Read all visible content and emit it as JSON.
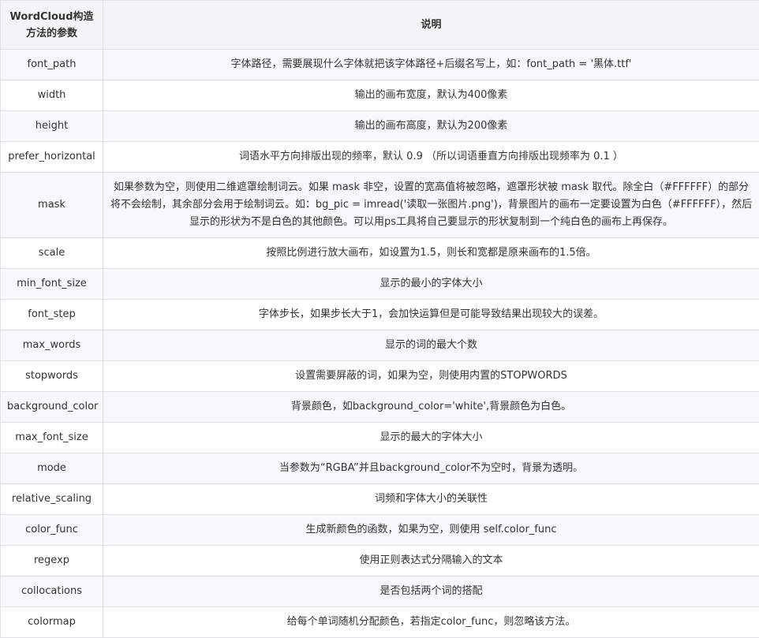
{
  "table": {
    "headers": [
      "WordCloud构造方法的参数",
      "说明"
    ],
    "rows": [
      {
        "param": "font_path",
        "desc": "字体路径，需要展现什么字体就把该字体路径+后缀名写上，如：font_path = '黑体.ttf'"
      },
      {
        "param": "width",
        "desc": "输出的画布宽度，默认为400像素"
      },
      {
        "param": "height",
        "desc": "输出的画布高度，默认为200像素"
      },
      {
        "param": "prefer_horizontal",
        "desc": "词语水平方向排版出现的频率，默认 0.9 （所以词语垂直方向排版出现频率为 0.1 ）"
      },
      {
        "param": "mask",
        "desc": "如果参数为空，则使用二维遮罩绘制词云。如果 mask 非空，设置的宽高值将被忽略，遮罩形状被 mask 取代。除全白（#FFFFFF）的部分将不会绘制，其余部分会用于绘制词云。如：bg_pic = imread('读取一张图片.png')，背景图片的画布一定要设置为白色（#FFFFFF），然后显示的形状为不是白色的其他颜色。可以用ps工具将自己要显示的形状复制到一个纯白色的画布上再保存。"
      },
      {
        "param": "scale",
        "desc": "按照比例进行放大画布，如设置为1.5，则长和宽都是原来画布的1.5倍。"
      },
      {
        "param": "min_font_size",
        "desc": "显示的最小的字体大小"
      },
      {
        "param": "font_step",
        "desc": "字体步长，如果步长大于1，会加快运算但是可能导致结果出现较大的误差。"
      },
      {
        "param": "max_words",
        "desc": "显示的词的最大个数"
      },
      {
        "param": "stopwords",
        "desc": "设置需要屏蔽的词，如果为空，则使用内置的STOPWORDS"
      },
      {
        "param": "background_color",
        "desc": "背景颜色，如background_color='white',背景颜色为白色。"
      },
      {
        "param": "max_font_size",
        "desc": "显示的最大的字体大小"
      },
      {
        "param": "mode",
        "desc": "当参数为“RGBA”并且background_color不为空时，背景为透明。"
      },
      {
        "param": "relative_scaling",
        "desc": "词频和字体大小的关联性"
      },
      {
        "param": "color_func",
        "desc": "生成新颜色的函数，如果为空，则使用 self.color_func"
      },
      {
        "param": "regexp",
        "desc": "使用正则表达式分隔输入的文本"
      },
      {
        "param": "collocations",
        "desc": "是否包括两个词的搭配"
      },
      {
        "param": "colormap",
        "desc": "给每个单词随机分配颜色，若指定color_func，则忽略该方法。"
      }
    ]
  },
  "colors": {
    "header_bg": "#f2f4f5",
    "stripe_bg": "#f6f8fa",
    "border": "#dfe2e5",
    "text": "#333333"
  }
}
